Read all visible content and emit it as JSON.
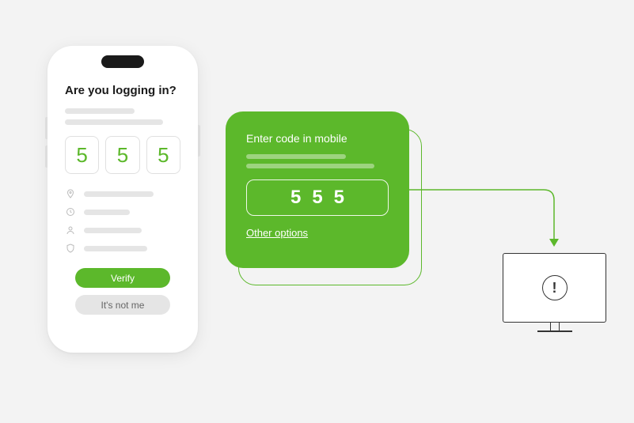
{
  "phone": {
    "title": "Are you logging in?",
    "code": [
      "5",
      "5",
      "5"
    ],
    "verify_label": "Verify",
    "notme_label": "It's not me"
  },
  "card": {
    "title": "Enter code in mobile",
    "code": [
      "5",
      "5",
      "5"
    ],
    "options_link": "Other options"
  },
  "colors": {
    "accent": "#5cb82b",
    "background": "#f3f3f3"
  }
}
